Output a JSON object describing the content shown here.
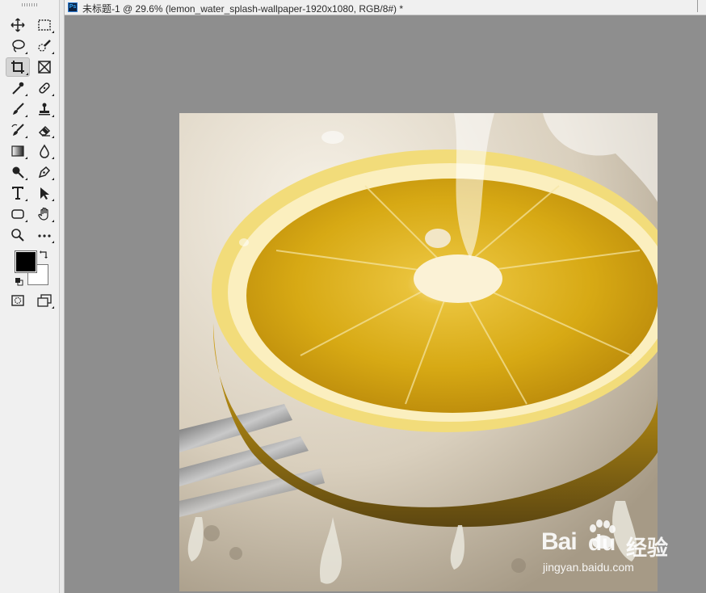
{
  "document": {
    "title": "未标题-1 @ 29.6% (lemon_water_splash-wallpaper-1920x1080, RGB/8#) *",
    "app_icon": "ps-icon",
    "app_icon_text": "Ps"
  },
  "toolbar": {
    "tools": [
      {
        "name": "move-tool",
        "icon": "move-icon"
      },
      {
        "name": "rectangular-marquee-tool",
        "icon": "marquee-icon"
      },
      {
        "name": "lasso-tool",
        "icon": "lasso-icon"
      },
      {
        "name": "quick-selection-tool",
        "icon": "quick-selection-icon"
      },
      {
        "name": "crop-tool",
        "icon": "crop-icon",
        "selected": true
      },
      {
        "name": "frame-tool",
        "icon": "frame-icon"
      },
      {
        "name": "eyedropper-tool",
        "icon": "eyedropper-icon"
      },
      {
        "name": "spot-healing-tool",
        "icon": "bandage-icon"
      },
      {
        "name": "brush-tool",
        "icon": "brush-icon"
      },
      {
        "name": "clone-stamp-tool",
        "icon": "stamp-icon"
      },
      {
        "name": "history-brush-tool",
        "icon": "history-brush-icon"
      },
      {
        "name": "eraser-tool",
        "icon": "eraser-icon"
      },
      {
        "name": "gradient-tool",
        "icon": "gradient-icon"
      },
      {
        "name": "blur-tool",
        "icon": "drop-icon"
      },
      {
        "name": "dodge-tool",
        "icon": "dodge-icon"
      },
      {
        "name": "pen-tool",
        "icon": "pen-icon"
      },
      {
        "name": "type-tool",
        "icon": "type-icon"
      },
      {
        "name": "path-selection-tool",
        "icon": "arrow-icon"
      },
      {
        "name": "rectangle-tool",
        "icon": "rounded-rect-icon"
      },
      {
        "name": "hand-tool",
        "icon": "hand-icon"
      },
      {
        "name": "zoom-tool",
        "icon": "zoom-icon"
      },
      {
        "name": "edit-toolbar",
        "icon": "more-icon"
      }
    ],
    "foreground_color": "#000000",
    "background_color": "#ffffff",
    "quick_mask_icon": "quick-mask-icon",
    "screen_mode_icon": "screen-mode-icon"
  },
  "canvas": {
    "image": "lemon-splash-image",
    "background": "#8e8e8e"
  },
  "watermark": {
    "brand_left": "Bai",
    "brand_right": "du",
    "brand_cn": "经验",
    "url": "jingyan.baidu.com"
  }
}
